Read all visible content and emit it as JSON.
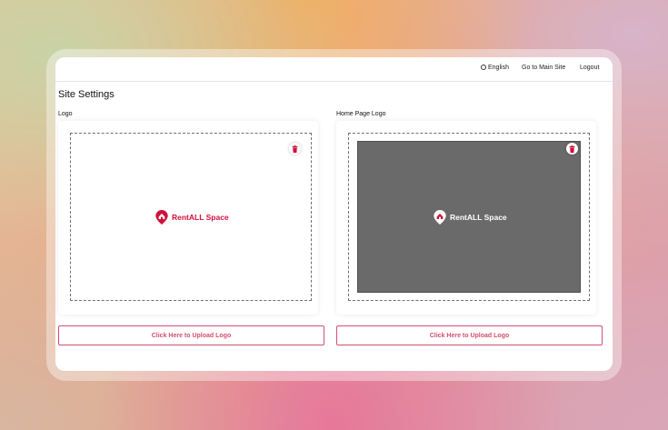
{
  "topbar": {
    "language": "English",
    "main_site": "Go to Main Site",
    "logout": "Logout"
  },
  "page": {
    "title": "Site Settings"
  },
  "logo_section": {
    "label": "Logo",
    "brand_text": "RentALL Space",
    "upload_label": "Click Here to Upload Logo"
  },
  "home_logo_section": {
    "label": "Home Page Logo",
    "brand_text": "RentALL Space",
    "upload_label": "Click Here to Upload Logo"
  },
  "colors": {
    "brand": "#d0103a",
    "accent_border": "#d2506f",
    "dark_preview": "#6a6a6a"
  },
  "icons": [
    "globe-icon",
    "trash-icon",
    "rentall-logo-icon"
  ]
}
